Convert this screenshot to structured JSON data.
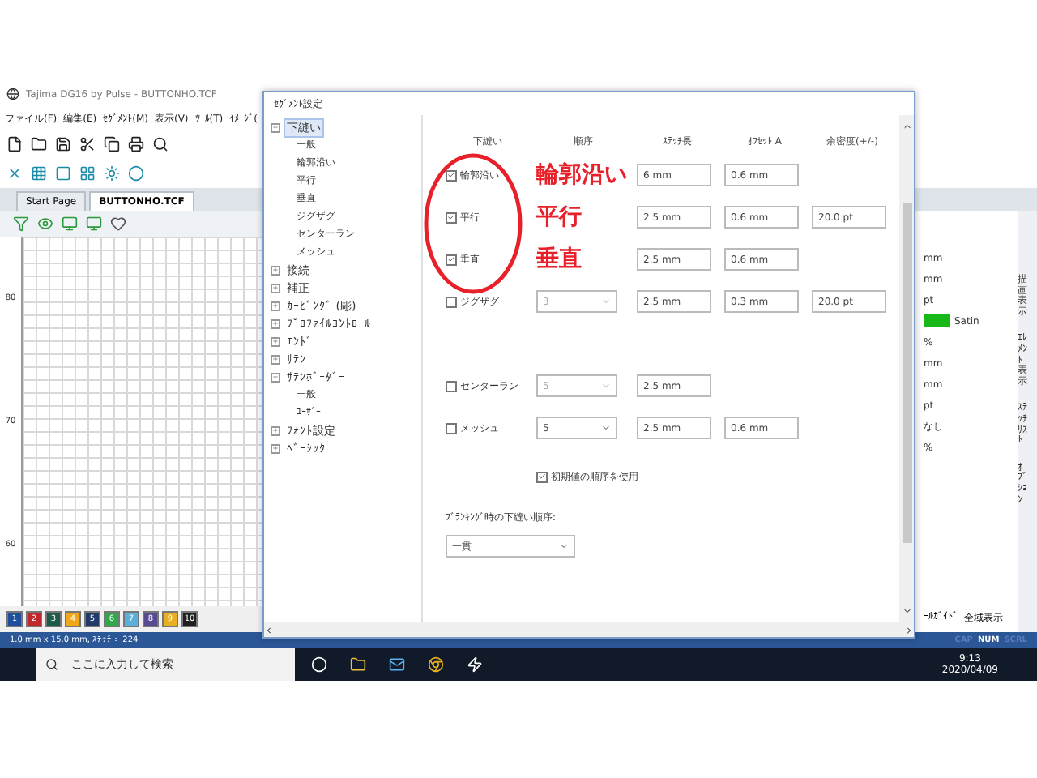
{
  "app": {
    "title": "Tajima DG16 by Pulse - BUTTONHO.TCF",
    "menu": [
      "ファイル(F)",
      "編集(E)",
      "ｾｸﾞﾒﾝﾄ(M)",
      "表示(V)",
      "ﾂｰﾙ(T)",
      "ｲﾒｰｼﾞ("
    ],
    "tabs": [
      {
        "label": "Start Page",
        "selected": false
      },
      {
        "label": "BUTTONHO.TCF",
        "selected": true
      }
    ],
    "ruler_labels": [
      "80",
      "70",
      "60"
    ],
    "palette": [
      {
        "label": "1",
        "color": "#1f4e9c"
      },
      {
        "label": "2",
        "color": "#c0282d"
      },
      {
        "label": "3",
        "color": "#1e5a4a"
      },
      {
        "label": "4",
        "color": "#f0a818"
      },
      {
        "label": "5",
        "color": "#223a6a"
      },
      {
        "label": "6",
        "color": "#2ea84a"
      },
      {
        "label": "7",
        "color": "#5ab0d8"
      },
      {
        "label": "8",
        "color": "#5a4a90"
      },
      {
        "label": "9",
        "color": "#e8b020"
      },
      {
        "label": "10",
        "color": "#202020"
      }
    ],
    "side_panel": {
      "vertical_tabs": [
        "描画表示",
        "ｴﾚﾒﾝﾄ表示",
        "ｽﾃｯﾁﾘｽﾄ",
        "ｵﾌﾞｼｮﾝ"
      ],
      "values": [
        {
          "text": "mm"
        },
        {
          "text": "mm"
        },
        {
          "text": "pt"
        },
        {
          "text": "Satin",
          "color": "#18b818"
        },
        {
          "text": "%"
        },
        {
          "text": "mm"
        },
        {
          "text": "mm"
        },
        {
          "text": "pt"
        },
        {
          "text": "なし"
        },
        {
          "text": "%"
        }
      ],
      "footer": [
        "ｰﾙｶﾞｲﾄﾞ",
        "全域表示"
      ]
    },
    "status_bar": {
      "text": "1.0 mm x 15.0 mm, ｽﾃｯﾁ： 224",
      "indicators": [
        {
          "label": "CAP",
          "on": false
        },
        {
          "label": "NUM",
          "on": true
        },
        {
          "label": "SCRL",
          "on": false
        }
      ]
    }
  },
  "dialog": {
    "title": "ｾｸﾞﾒﾝﾄ設定",
    "tree": [
      {
        "label": "下縫い",
        "selected": true,
        "expanded": true,
        "children": [
          {
            "label": "一般",
            "selected": false
          },
          {
            "label": "輪郭沿い",
            "selected": false
          },
          {
            "label": "平行",
            "selected": false
          },
          {
            "label": "垂直",
            "selected": false
          },
          {
            "label": "ジグザグ",
            "selected": false
          },
          {
            "label": "センターラン",
            "selected": false
          },
          {
            "label": "メッシュ",
            "selected": false
          }
        ]
      },
      {
        "label": "接続",
        "selected": false,
        "expanded": false
      },
      {
        "label": "補正",
        "selected": false,
        "expanded": false
      },
      {
        "label": "ｶｰﾋﾞﾝｸﾞ (彫)",
        "selected": false,
        "expanded": false
      },
      {
        "label": "ﾌﾟﾛﾌｧｲﾙｺﾝﾄﾛｰﾙ",
        "selected": false,
        "expanded": false
      },
      {
        "label": "ｴﾝﾄﾞ",
        "selected": false,
        "expanded": false
      },
      {
        "label": "ｻﾃﾝ",
        "selected": false,
        "expanded": false
      },
      {
        "label": "ｻﾃﾝﾎﾞｰﾀﾞｰ",
        "selected": false,
        "expanded": true,
        "children": [
          {
            "label": "一般",
            "selected": false
          },
          {
            "label": "ﾕｰｻﾞｰ",
            "selected": false
          }
        ]
      },
      {
        "label": "ﾌｫﾝﾄ設定",
        "selected": false,
        "expanded": false
      },
      {
        "label": "ﾍﾞｰｼｯｸ",
        "selected": false,
        "expanded": false
      }
    ],
    "columns": [
      "下縫い",
      "順序",
      "ｽﾃｯﾁ長",
      "ｵﾌｾｯﾄ A",
      "余密度(+/-)"
    ],
    "rows": [
      {
        "label": "輪郭沿い",
        "checked": true,
        "fields": [
          {
            "kind": "blank"
          },
          {
            "kind": "text",
            "value": "6 mm"
          },
          {
            "kind": "text",
            "value": "0.6 mm"
          }
        ]
      },
      {
        "label": "平行",
        "checked": true,
        "fields": [
          {
            "kind": "blank"
          },
          {
            "kind": "text",
            "value": "2.5 mm"
          },
          {
            "kind": "text",
            "value": "0.6 mm"
          },
          {
            "kind": "text",
            "value": "20.0 pt"
          }
        ]
      },
      {
        "label": "垂直",
        "checked": true,
        "fields": [
          {
            "kind": "blank"
          },
          {
            "kind": "text",
            "value": "2.5 mm"
          },
          {
            "kind": "text",
            "value": "0.6 mm"
          }
        ]
      },
      {
        "label": "ジグザグ",
        "checked": false,
        "fields": [
          {
            "kind": "select",
            "value": "3",
            "disabled": true
          },
          {
            "kind": "text",
            "value": "2.5 mm"
          },
          {
            "kind": "text",
            "value": "0.3 mm"
          },
          {
            "kind": "text",
            "value": "20.0 pt"
          }
        ]
      },
      {
        "label": "センターラン",
        "checked": false,
        "gap": true,
        "fields": [
          {
            "kind": "select",
            "value": "5",
            "disabled": true
          },
          {
            "kind": "text",
            "value": "2.5 mm"
          }
        ]
      },
      {
        "label": "メッシュ",
        "checked": false,
        "fields": [
          {
            "kind": "select",
            "value": "5",
            "disabled": false
          },
          {
            "kind": "text",
            "value": "2.5 mm"
          },
          {
            "kind": "text",
            "value": "0.6 mm"
          }
        ]
      }
    ],
    "default_order": {
      "label": "初期値の順序を使用",
      "checked": true
    },
    "blanking": {
      "label": "ﾌﾞﾗﾝｷﾝｸﾞ時の下縫い順序:",
      "value": "一貫"
    },
    "annotation": {
      "lines": [
        "輪郭沿い",
        "平行",
        "垂直"
      ]
    }
  },
  "taskbar": {
    "search": {
      "placeholder": "ここに入力して検索"
    },
    "time": "9:13",
    "date": "2020/04/09"
  }
}
